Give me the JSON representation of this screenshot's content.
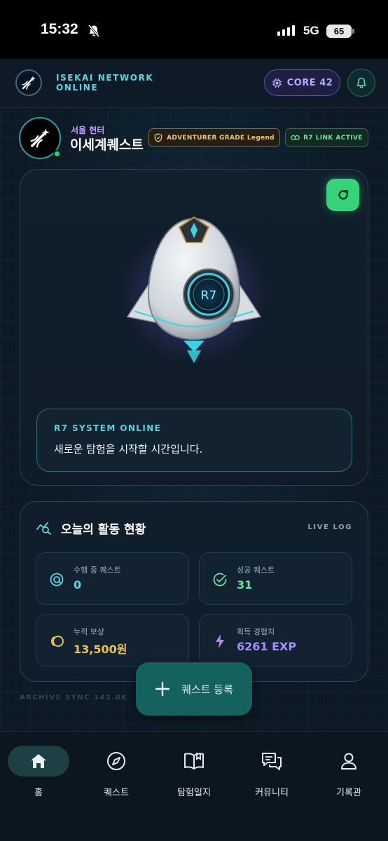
{
  "status_bar": {
    "time": "15:32",
    "network": "5G",
    "battery": "65"
  },
  "header": {
    "brand_line1": "ISEKAI NETWORK",
    "brand_line2": "ONLINE",
    "core_label": "CORE 42"
  },
  "profile": {
    "region": "서울 헌터",
    "name": "이세계퀘스트",
    "grade_badge": "ADVENTURER GRADE Legend",
    "link_badge": "R7 LINK ACTIVE",
    "robot_label": "R7"
  },
  "system": {
    "title": "R7 SYSTEM ONLINE",
    "message": "새로운 탐험을 시작할 시간입니다."
  },
  "stats": {
    "title": "오늘의 활동 현황",
    "live_log": "LIVE LOG",
    "items": [
      {
        "label": "수행 중 퀘스트",
        "value": "0",
        "icon": "target-icon",
        "color": "#5fd4e4"
      },
      {
        "label": "성공 퀘스트",
        "value": "31",
        "icon": "check-circle-icon",
        "color": "#6fe0a5"
      },
      {
        "label": "누적 보상",
        "value": "13,500원",
        "icon": "coin-icon",
        "color": "#f2c14e"
      },
      {
        "label": "획득 경험치",
        "value": "6261 EXP",
        "icon": "bolt-icon",
        "color": "#a98cff"
      }
    ]
  },
  "archive_text": "ARCHIVE SYNC  142.0K",
  "fab": {
    "label": "퀘스트 등록"
  },
  "nav": {
    "items": [
      {
        "label": "홈",
        "icon": "home-icon",
        "active": true
      },
      {
        "label": "퀘스트",
        "icon": "compass-icon",
        "active": false
      },
      {
        "label": "탐험일지",
        "icon": "book-icon",
        "active": false
      },
      {
        "label": "커뮤니티",
        "icon": "chat-icon",
        "active": false
      },
      {
        "label": "기록관",
        "icon": "user-icon",
        "active": false
      }
    ]
  }
}
